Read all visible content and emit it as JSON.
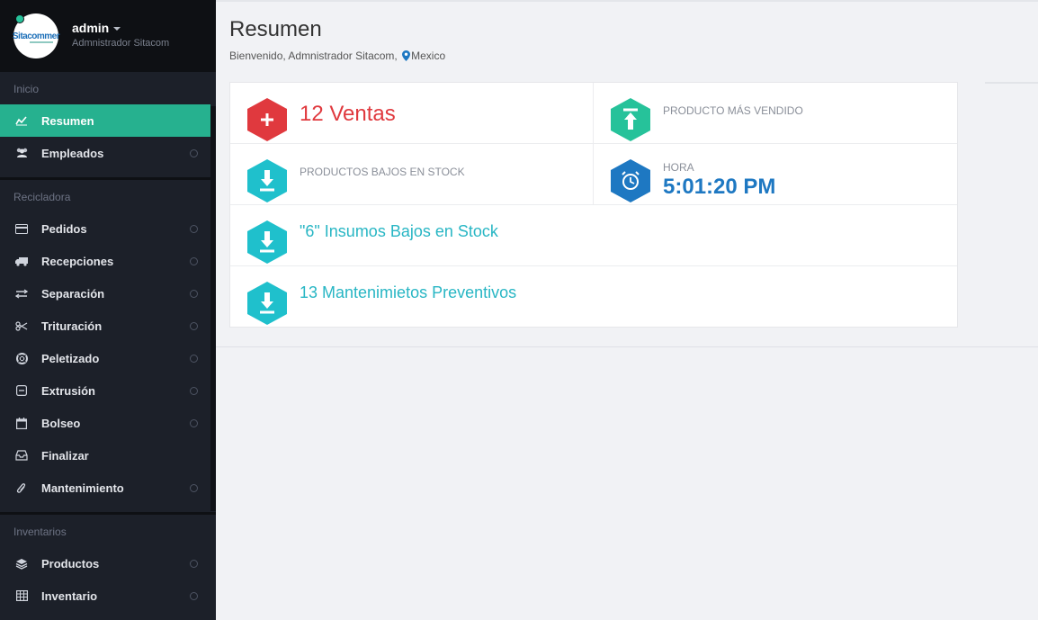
{
  "profile": {
    "logo_text": "Sitacommer",
    "username": "admin",
    "role": "Admnistrador Sitacom"
  },
  "sidebar": {
    "sections": [
      {
        "title": "Inicio"
      },
      {
        "title": "Recicladora"
      },
      {
        "title": "Inventarios"
      }
    ],
    "items": [
      {
        "label": "Resumen",
        "icon": "chart-line-icon",
        "active": true
      },
      {
        "label": "Empleados",
        "icon": "users-icon"
      },
      {
        "label": "Pedidos",
        "icon": "credit-card-icon"
      },
      {
        "label": "Recepciones",
        "icon": "truck-icon"
      },
      {
        "label": "Separación",
        "icon": "transfer-icon"
      },
      {
        "label": "Trituración",
        "icon": "scissors-icon"
      },
      {
        "label": "Peletizado",
        "icon": "life-ring-icon"
      },
      {
        "label": "Extrusión",
        "icon": "minus-box-icon"
      },
      {
        "label": "Bolseo",
        "icon": "calendar-icon"
      },
      {
        "label": "Finalizar",
        "icon": "inbox-icon"
      },
      {
        "label": "Mantenimiento",
        "icon": "paperclip-icon"
      },
      {
        "label": "Productos",
        "icon": "layers-icon"
      },
      {
        "label": "Inventario",
        "icon": "table-icon"
      }
    ],
    "active_color": "#26b18f"
  },
  "header": {
    "title": "Resumen",
    "welcome": "Bienvenido, Admnistrador Sitacom,",
    "location": "Mexico"
  },
  "stats": {
    "ventas": "12 Ventas",
    "producto_mas_vendido": "PRODUCTO MÁS VENDIDO",
    "productos_bajos": "PRODUCTOS BAJOS EN STOCK",
    "hora_label": "HORA",
    "hora_value": "5:01:20 PM",
    "insumos": "\"6\" Insumos Bajos en Stock",
    "mantenimientos": "13 Mantenimietos Preventivos"
  },
  "colors": {
    "red": "#e0393e",
    "green": "#26c29a",
    "teal": "#1fc0cc",
    "blue": "#1e78c2"
  }
}
